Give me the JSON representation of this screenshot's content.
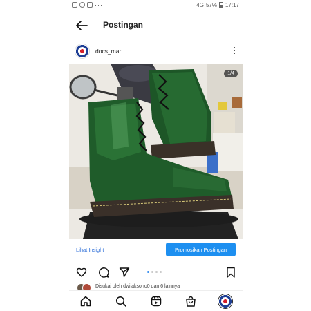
{
  "status_bar": {
    "app_icons": [
      "instagram-icon",
      "whatsapp-icon",
      "facebook-icon"
    ],
    "more": "···",
    "signal_text": "4G",
    "battery": "57%",
    "time": "17:17"
  },
  "header": {
    "title": "Postingan",
    "back_icon": "arrow-left-icon"
  },
  "post": {
    "username": "docs_mart",
    "image_counter": "1/4",
    "image_index": 0,
    "image_count": 4,
    "image_description_icon": "green-boots-photo"
  },
  "insight": {
    "link": "Lihat Insight",
    "promote_button": "Promosikan Postingan"
  },
  "liked": {
    "text": "Disukai oleh dwilaksono0 dan 6 lainnya"
  },
  "colors": {
    "accent": "#1d8ff0",
    "link": "#2f6fd8",
    "boot_green": "#1f5c2a"
  }
}
